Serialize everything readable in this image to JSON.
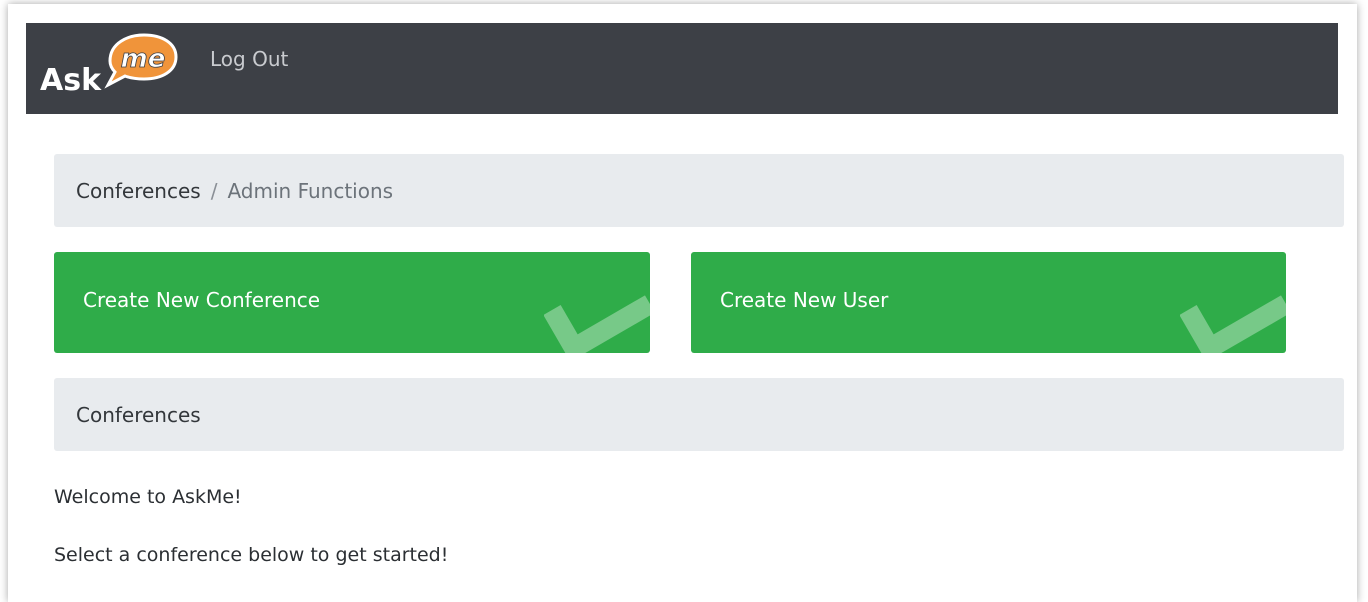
{
  "app": {
    "logo_word": "Ask",
    "logo_bubble": "me",
    "logout_label": "Log Out"
  },
  "breadcrumb": {
    "items": [
      {
        "label": "Conferences"
      },
      {
        "label": "Admin Functions"
      }
    ],
    "separator": "/"
  },
  "actions": [
    {
      "label": "Create New Conference",
      "icon": "check-icon"
    },
    {
      "label": "Create New User",
      "icon": "check-icon"
    }
  ],
  "section": {
    "title": "Conferences"
  },
  "content": {
    "welcome": "Welcome to AskMe!",
    "instruction": "Select a conference below to get started!"
  },
  "colors": {
    "navbar": "#3d4046",
    "accent_orange": "#f0943a",
    "action_green": "#2fac49",
    "panel_gray": "#e8ebee"
  }
}
